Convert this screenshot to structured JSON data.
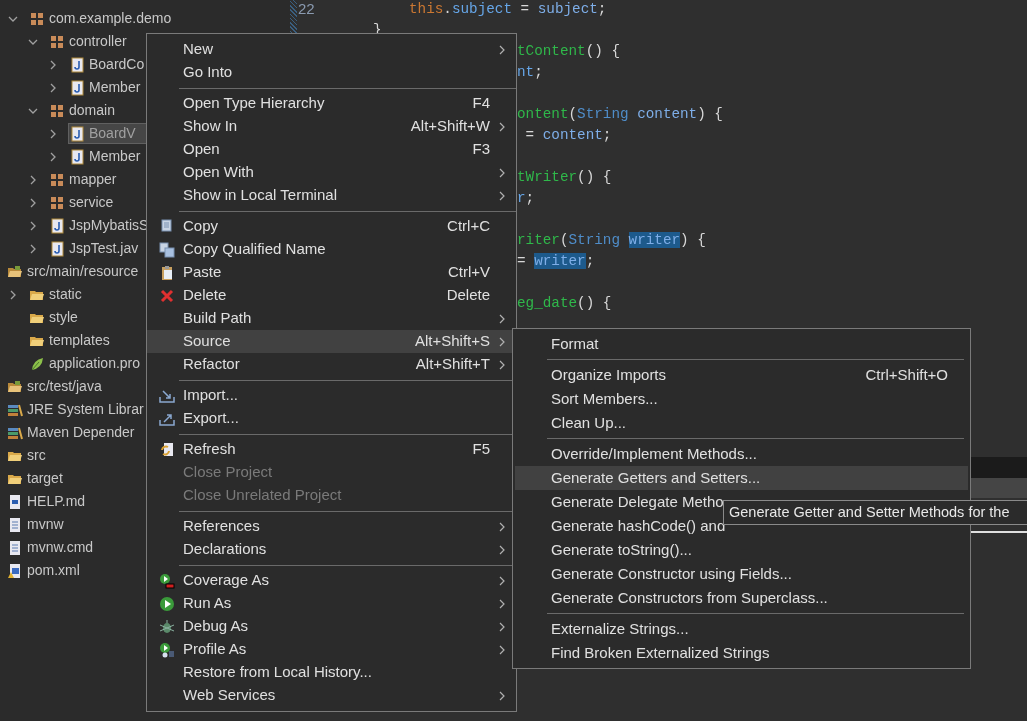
{
  "explorer": {
    "tree": [
      {
        "label": "com.example.demo",
        "kind": "package",
        "expanded": true,
        "selected": false,
        "children": [
          {
            "label": "controller",
            "kind": "package",
            "expanded": true,
            "selected": false,
            "children": [
              {
                "label": "BoardCo",
                "kind": "java",
                "expanded": false,
                "selected": false
              },
              {
                "label": "Member",
                "kind": "java",
                "expanded": false,
                "selected": false
              }
            ]
          },
          {
            "label": "domain",
            "kind": "package",
            "expanded": true,
            "selected": false,
            "children": [
              {
                "label": "BoardV",
                "kind": "java",
                "expanded": false,
                "selected": true
              },
              {
                "label": "Member",
                "kind": "java",
                "expanded": false,
                "selected": false
              }
            ]
          },
          {
            "label": "mapper",
            "kind": "package",
            "expanded": false,
            "selected": false
          },
          {
            "label": "service",
            "kind": "package",
            "expanded": false,
            "selected": false
          },
          {
            "label": "JspMybatisS",
            "kind": "java",
            "expanded": false,
            "selected": false
          },
          {
            "label": "JspTest.jav",
            "kind": "java",
            "expanded": false,
            "selected": false
          }
        ]
      },
      {
        "label": "src/main/resource",
        "kind": "source-folder",
        "selected": false,
        "children": [
          {
            "label": "static",
            "kind": "folder",
            "expanded": false,
            "selected": false
          },
          {
            "label": "style",
            "kind": "folder",
            "selected": false
          },
          {
            "label": "templates",
            "kind": "folder",
            "selected": false
          },
          {
            "label": "application.pro",
            "kind": "properties",
            "selected": false
          }
        ]
      },
      {
        "label": "src/test/java",
        "kind": "source-folder",
        "selected": false
      },
      {
        "label": "JRE System Librar",
        "kind": "library",
        "selected": false
      },
      {
        "label": "Maven Depender",
        "kind": "library",
        "selected": false
      },
      {
        "label": "src",
        "kind": "folder",
        "selected": false
      },
      {
        "label": "target",
        "kind": "folder",
        "selected": false
      },
      {
        "label": "HELP.md",
        "kind": "document",
        "selected": false
      },
      {
        "label": "mvnw",
        "kind": "text",
        "selected": false
      },
      {
        "label": "mvnw.cmd",
        "kind": "text",
        "selected": false
      },
      {
        "label": "pom.xml",
        "kind": "maven",
        "selected": false
      }
    ]
  },
  "editor": {
    "lines": [
      {
        "number": "22",
        "kind": "body",
        "segments": [
          {
            "t": "this",
            "kind": "keyword"
          },
          {
            "t": ".",
            "kind": "plain"
          },
          {
            "t": "subject",
            "kind": "field"
          },
          {
            "t": " = ",
            "kind": "plain"
          },
          {
            "t": "subject",
            "kind": "param"
          },
          {
            "t": ";",
            "kind": "plain"
          }
        ]
      },
      {
        "kind": "end",
        "segments": [
          {
            "t": "}",
            "kind": "plain"
          }
        ]
      },
      {
        "kind": "tail",
        "segments": [
          {
            "t": "tContent",
            "kind": "method"
          },
          {
            "t": "() {",
            "kind": "plain"
          }
        ]
      },
      {
        "kind": "tail",
        "segments": [
          {
            "t": "nt",
            "kind": "field"
          },
          {
            "t": ";",
            "kind": "plain"
          }
        ]
      },
      {
        "kind": "blank"
      },
      {
        "kind": "tail",
        "segments": [
          {
            "t": "ontent",
            "kind": "method"
          },
          {
            "t": "(",
            "kind": "plain"
          },
          {
            "t": "String ",
            "kind": "type"
          },
          {
            "t": "content",
            "kind": "param"
          },
          {
            "t": ") {",
            "kind": "plain"
          }
        ]
      },
      {
        "kind": "tail",
        "segments": [
          {
            "t": " = ",
            "kind": "plain"
          },
          {
            "t": "content",
            "kind": "param"
          },
          {
            "t": ";",
            "kind": "plain"
          }
        ]
      },
      {
        "kind": "blank"
      },
      {
        "kind": "tail",
        "segments": [
          {
            "t": "tWriter",
            "kind": "method"
          },
          {
            "t": "() {",
            "kind": "plain"
          }
        ]
      },
      {
        "kind": "tail",
        "segments": [
          {
            "t": "r",
            "kind": "field"
          },
          {
            "t": ";",
            "kind": "plain"
          }
        ]
      },
      {
        "kind": "blank"
      },
      {
        "kind": "tail",
        "segments": [
          {
            "t": "riter",
            "kind": "method"
          },
          {
            "t": "(",
            "kind": "plain"
          },
          {
            "t": "String ",
            "kind": "type"
          },
          {
            "t": "writer",
            "kind": "param",
            "highlighted": true
          },
          {
            "t": ") {",
            "kind": "plain"
          }
        ]
      },
      {
        "kind": "tail",
        "segments": [
          {
            "t": "= ",
            "kind": "plain"
          },
          {
            "t": "writer",
            "kind": "param",
            "highlighted": true
          },
          {
            "t": ";",
            "kind": "plain"
          }
        ]
      },
      {
        "kind": "blank"
      },
      {
        "kind": "tail",
        "segments": [
          {
            "t": "eg_date",
            "kind": "method"
          },
          {
            "t": "() {",
            "kind": "plain"
          }
        ]
      }
    ]
  },
  "context_menu": {
    "items": [
      {
        "kind": "plain",
        "label": "New",
        "submenu": true,
        "disabled": false,
        "selected": false
      },
      {
        "kind": "plain",
        "label": "Go Into",
        "submenu": false,
        "disabled": false,
        "selected": false
      },
      {
        "kind": "separator"
      },
      {
        "kind": "plain",
        "label": "Open Type Hierarchy",
        "shortcut": "F4",
        "submenu": false,
        "disabled": false,
        "selected": false
      },
      {
        "kind": "plain",
        "label": "Show In",
        "shortcut": "Alt+Shift+W",
        "submenu": true,
        "disabled": false,
        "selected": false
      },
      {
        "kind": "plain",
        "label": "Open",
        "shortcut": "F3",
        "submenu": false,
        "disabled": false,
        "selected": false
      },
      {
        "kind": "plain",
        "label": "Open With",
        "submenu": true,
        "disabled": false,
        "selected": false
      },
      {
        "kind": "plain",
        "label": "Show in Local Terminal",
        "submenu": true,
        "disabled": false,
        "selected": false
      },
      {
        "kind": "separator"
      },
      {
        "kind": "copy",
        "label": "Copy",
        "shortcut": "Ctrl+C",
        "submenu": false,
        "disabled": false,
        "selected": false
      },
      {
        "kind": "copy-qualified",
        "label": "Copy Qualified Name",
        "submenu": false,
        "disabled": false,
        "selected": false
      },
      {
        "kind": "paste",
        "label": "Paste",
        "shortcut": "Ctrl+V",
        "submenu": false,
        "disabled": false,
        "selected": false
      },
      {
        "kind": "delete",
        "label": "Delete",
        "shortcut": "Delete",
        "submenu": false,
        "disabled": false,
        "selected": false
      },
      {
        "kind": "plain",
        "label": "Build Path",
        "submenu": true,
        "disabled": false,
        "selected": false
      },
      {
        "kind": "plain",
        "label": "Source",
        "shortcut": "Alt+Shift+S",
        "submenu": true,
        "disabled": false,
        "selected": true
      },
      {
        "kind": "plain",
        "label": "Refactor",
        "shortcut": "Alt+Shift+T",
        "submenu": true,
        "disabled": false,
        "selected": false
      },
      {
        "kind": "separator"
      },
      {
        "kind": "import",
        "label": "Import...",
        "submenu": false,
        "disabled": false,
        "selected": false
      },
      {
        "kind": "export",
        "label": "Export...",
        "submenu": false,
        "disabled": false,
        "selected": false
      },
      {
        "kind": "separator"
      },
      {
        "kind": "refresh",
        "label": "Refresh",
        "shortcut": "F5",
        "submenu": false,
        "disabled": false,
        "selected": false
      },
      {
        "kind": "plain",
        "label": "Close Project",
        "submenu": false,
        "disabled": true,
        "selected": false
      },
      {
        "kind": "plain",
        "label": "Close Unrelated Project",
        "submenu": false,
        "disabled": true,
        "selected": false
      },
      {
        "kind": "separator"
      },
      {
        "kind": "plain",
        "label": "References",
        "submenu": true,
        "disabled": false,
        "selected": false
      },
      {
        "kind": "plain",
        "label": "Declarations",
        "submenu": true,
        "disabled": false,
        "selected": false
      },
      {
        "kind": "separator"
      },
      {
        "kind": "coverage",
        "label": "Coverage As",
        "submenu": true,
        "disabled": false,
        "selected": false
      },
      {
        "kind": "run",
        "label": "Run As",
        "submenu": true,
        "disabled": false,
        "selected": false
      },
      {
        "kind": "debug",
        "label": "Debug As",
        "submenu": true,
        "disabled": false,
        "selected": false
      },
      {
        "kind": "profile",
        "label": "Profile As",
        "submenu": true,
        "disabled": false,
        "selected": false
      },
      {
        "kind": "plain",
        "label": "Restore from Local History...",
        "submenu": false,
        "disabled": false,
        "selected": false
      },
      {
        "kind": "plain",
        "label": "Web Services",
        "submenu": true,
        "disabled": false,
        "selected": false
      }
    ]
  },
  "source_submenu": {
    "items": [
      {
        "kind": "plain",
        "label": "Format",
        "selected": false
      },
      {
        "kind": "separator"
      },
      {
        "kind": "plain",
        "label": "Organize Imports",
        "shortcut": "Ctrl+Shift+O",
        "selected": false
      },
      {
        "kind": "plain",
        "label": "Sort Members...",
        "selected": false
      },
      {
        "kind": "plain",
        "label": "Clean Up...",
        "selected": false
      },
      {
        "kind": "separator"
      },
      {
        "kind": "plain",
        "label": "Override/Implement Methods...",
        "selected": false
      },
      {
        "kind": "plain",
        "label": "Generate Getters and Setters...",
        "selected": true
      },
      {
        "kind": "plain",
        "label": "Generate Delegate Metho",
        "selected": false
      },
      {
        "kind": "plain",
        "label": "Generate hashCode() and",
        "selected": false
      },
      {
        "kind": "plain",
        "label": "Generate toString()...",
        "selected": false
      },
      {
        "kind": "plain",
        "label": "Generate Constructor using Fields...",
        "selected": false
      },
      {
        "kind": "plain",
        "label": "Generate Constructors from Superclass...",
        "selected": false
      },
      {
        "kind": "separator"
      },
      {
        "kind": "plain",
        "label": "Externalize Strings...",
        "selected": false
      },
      {
        "kind": "plain",
        "label": "Find Broken Externalized Strings",
        "selected": false
      }
    ]
  },
  "tooltip": {
    "text": "Generate Getter and Setter Methods for the"
  }
}
